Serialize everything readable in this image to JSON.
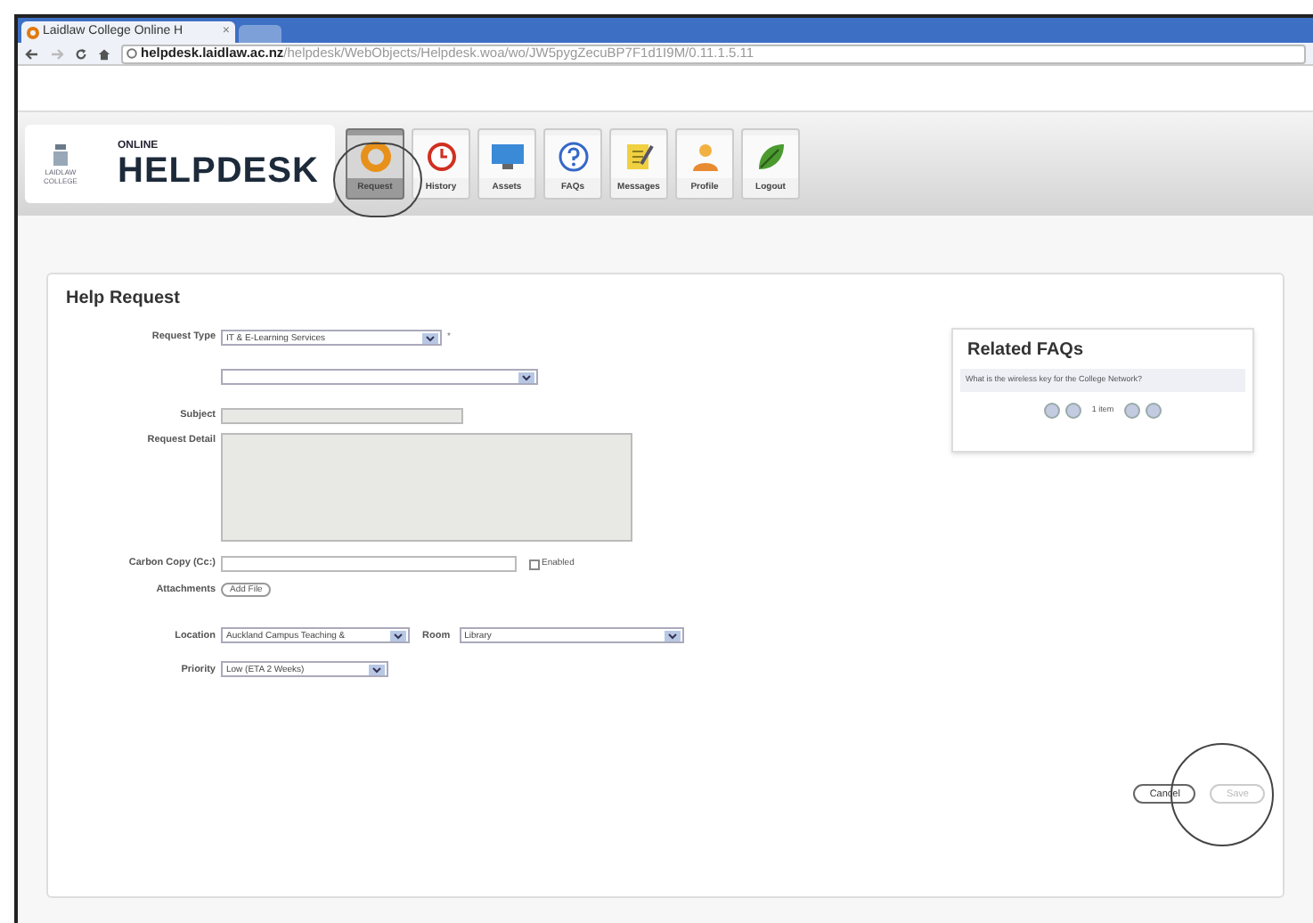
{
  "browser": {
    "tab_title": "Laidlaw College Online H",
    "tab_close": "×",
    "url_host": "helpdesk.laidlaw.ac.nz",
    "url_path": "/helpdesk/WebObjects/Helpdesk.woa/wo/JW5pygZecuBP7F1d1I9M/0.11.1.5.11"
  },
  "logo": {
    "college": "LAIDLAW COLLEGE",
    "small": "ONLINE",
    "big": "HELPDESK"
  },
  "nav": [
    {
      "label": "Request",
      "kind": "request",
      "selected": true
    },
    {
      "label": "History",
      "kind": "history",
      "selected": false
    },
    {
      "label": "Assets",
      "kind": "assets",
      "selected": false
    },
    {
      "label": "FAQs",
      "kind": "faqs",
      "selected": false
    },
    {
      "label": "Messages",
      "kind": "messages",
      "selected": false
    },
    {
      "label": "Profile",
      "kind": "profile",
      "selected": false
    },
    {
      "label": "Logout",
      "kind": "logout",
      "selected": false
    }
  ],
  "form": {
    "title": "Help Request",
    "request_type": {
      "label": "Request Type",
      "value": "IT & E-Learning Services",
      "required": "*"
    },
    "subject": {
      "label": "Subject",
      "disabled": true
    },
    "detail": {
      "label": "Request Detail",
      "disabled": true
    },
    "cc": {
      "label": "Carbon Copy (Cc:)",
      "checkbox_label": "Enabled",
      "checked": false
    },
    "attachments": {
      "label": "Attachments",
      "button": "Add File"
    },
    "location": {
      "label": "Location",
      "value": "Auckland Campus Teaching &"
    },
    "room": {
      "label": "Room",
      "value": "Library"
    },
    "priority": {
      "label": "Priority",
      "value": "Low (ETA 2 Weeks)"
    },
    "buttons": [
      {
        "label": "Cancel",
        "disabled": false
      },
      {
        "label": "Save",
        "disabled": true
      }
    ]
  },
  "related_faqs": {
    "title": "Related FAQs",
    "items": [
      "What is the wireless key for the College Network?"
    ],
    "pager": "1 item"
  }
}
